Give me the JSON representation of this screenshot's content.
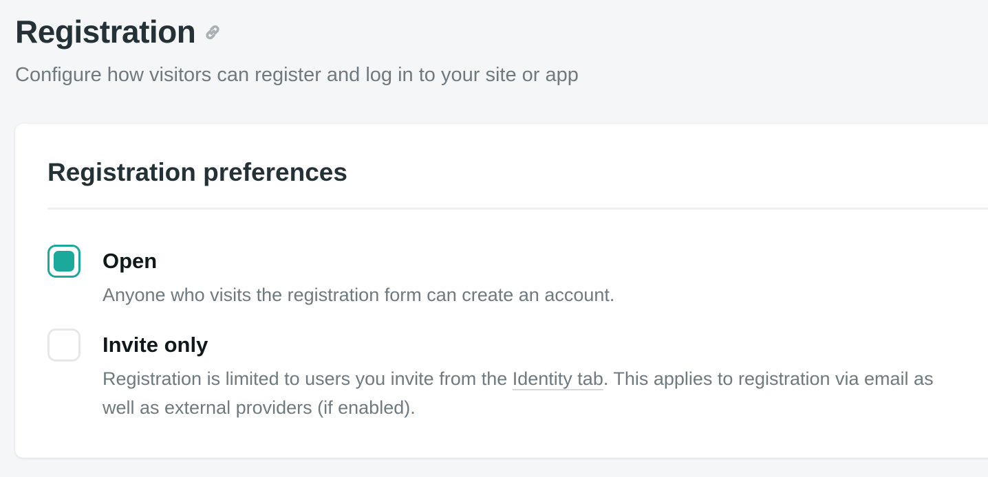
{
  "header": {
    "title": "Registration",
    "subtitle": "Configure how visitors can register and log in to your site or app",
    "link_icon": "link-icon"
  },
  "card": {
    "title": "Registration preferences",
    "options": [
      {
        "label": "Open",
        "description": "Anyone who visits the registration form can create an account.",
        "selected": true
      },
      {
        "label": "Invite only",
        "description_before": "Registration is limited to users you invite from the ",
        "description_link": "Identity tab",
        "description_after": ". This applies to registration via email as well as external providers (if enabled).",
        "selected": false
      }
    ]
  },
  "colors": {
    "accent": "#1aa99b",
    "heading": "#243238",
    "muted_text": "#6f7a80",
    "page_bg": "#f4f6f7"
  }
}
